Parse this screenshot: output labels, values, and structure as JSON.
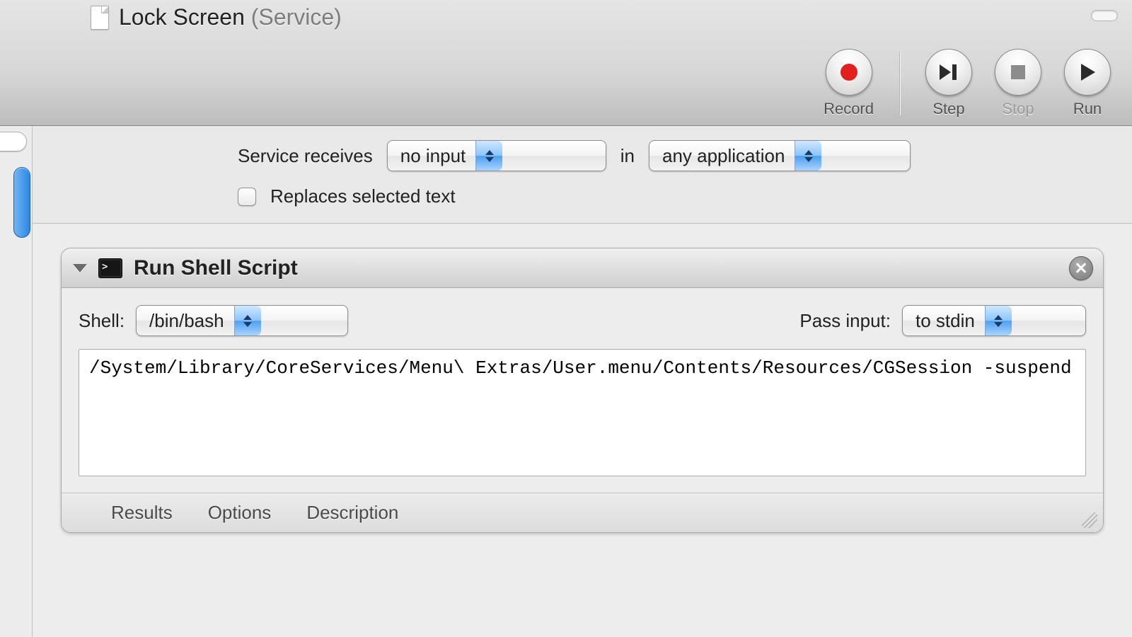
{
  "window": {
    "title": "Lock Screen",
    "suffix": "(Service)"
  },
  "toolbar": {
    "record": "Record",
    "step": "Step",
    "stop": "Stop",
    "run": "Run"
  },
  "config": {
    "receives_label": "Service receives",
    "input_type": "no input",
    "in_label": "in",
    "app_scope": "any application",
    "replaces_label": "Replaces selected text",
    "replaces_checked": false
  },
  "action": {
    "title": "Run Shell Script",
    "shell_label": "Shell:",
    "shell_value": "/bin/bash",
    "pass_label": "Pass input:",
    "pass_value": "to stdin",
    "script": "/System/Library/CoreServices/Menu\\ Extras/User.menu/Contents/Resources/CGSession -suspend",
    "tabs": {
      "results": "Results",
      "options": "Options",
      "description": "Description"
    }
  }
}
